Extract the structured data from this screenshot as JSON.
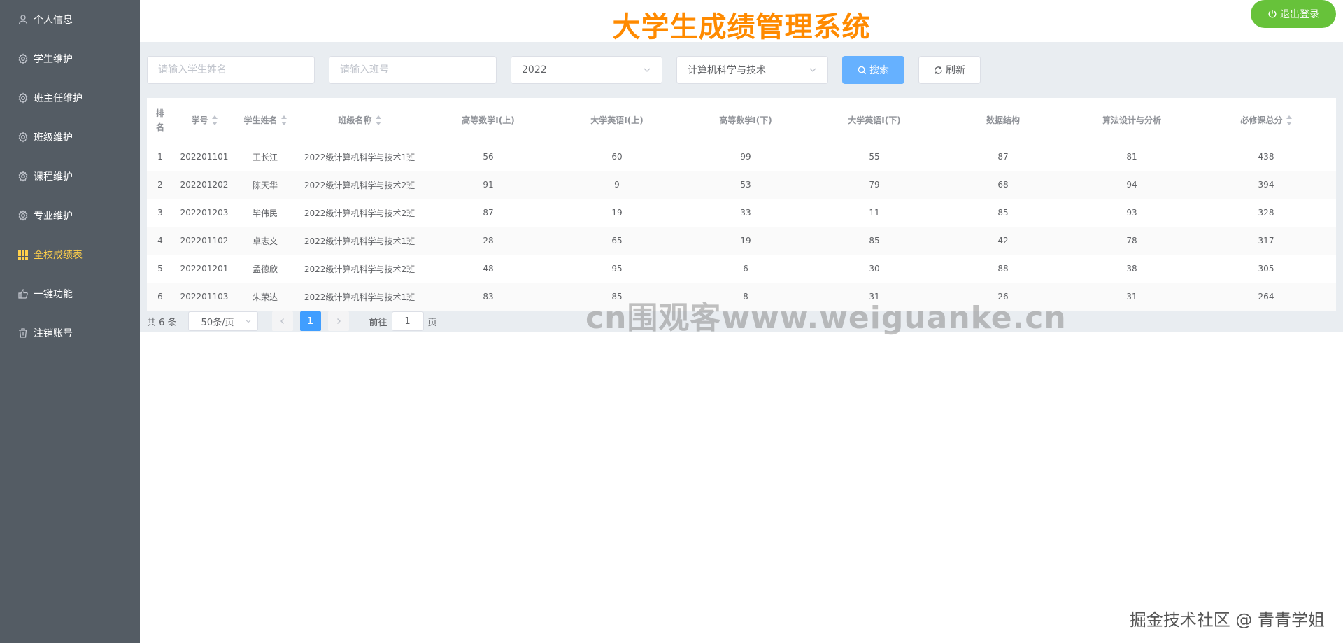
{
  "sidebar": {
    "items": [
      {
        "label": "个人信息",
        "icon": "user-icon",
        "active": false
      },
      {
        "label": "学生维护",
        "icon": "gear-icon",
        "active": false
      },
      {
        "label": "班主任维护",
        "icon": "gear-icon",
        "active": false
      },
      {
        "label": "班级维护",
        "icon": "gear-icon",
        "active": false
      },
      {
        "label": "课程维护",
        "icon": "gear-icon",
        "active": false
      },
      {
        "label": "专业维护",
        "icon": "gear-icon",
        "active": false
      },
      {
        "label": "全校成绩表",
        "icon": "grid-icon",
        "active": true
      },
      {
        "label": "一键功能",
        "icon": "thumb-icon",
        "active": false
      },
      {
        "label": "注销账号",
        "icon": "trash-icon",
        "active": false
      }
    ],
    "active_color": "#ffd04b",
    "background": "#545c64"
  },
  "header": {
    "title": "大学生成绩管理系统",
    "title_color": "#ff8a00",
    "logout_label": "退出登录"
  },
  "filters": {
    "name_placeholder": "请输入学生姓名",
    "class_placeholder": "请输入班号",
    "year_value": "2022",
    "major_value": "计算机科学与技术",
    "search_label": "搜索",
    "refresh_label": "刷新"
  },
  "table": {
    "headers": {
      "rank": "排名",
      "student_no": "学号",
      "name": "学生姓名",
      "class_name": "班级名称",
      "math1": "高等数学I(上)",
      "english1": "大学英语I(上)",
      "math2": "高等数学I(下)",
      "english2": "大学英语I(下)",
      "ds": "数据结构",
      "algo": "算法设计与分析",
      "total": "必修课总分"
    },
    "rows": [
      {
        "rank": "1",
        "student_no": "202201101",
        "name": "王长江",
        "class_name": "2022级计算机科学与技术1班",
        "math1": "56",
        "english1": "60",
        "math2": "99",
        "english2": "55",
        "ds": "87",
        "algo": "81",
        "total": "438"
      },
      {
        "rank": "2",
        "student_no": "202201202",
        "name": "陈天华",
        "class_name": "2022级计算机科学与技术2班",
        "math1": "91",
        "english1": "9",
        "math2": "53",
        "english2": "79",
        "ds": "68",
        "algo": "94",
        "total": "394"
      },
      {
        "rank": "3",
        "student_no": "202201203",
        "name": "毕伟民",
        "class_name": "2022级计算机科学与技术2班",
        "math1": "87",
        "english1": "19",
        "math2": "33",
        "english2": "11",
        "ds": "85",
        "algo": "93",
        "total": "328"
      },
      {
        "rank": "4",
        "student_no": "202201102",
        "name": "卓志文",
        "class_name": "2022级计算机科学与技术1班",
        "math1": "28",
        "english1": "65",
        "math2": "19",
        "english2": "85",
        "ds": "42",
        "algo": "78",
        "total": "317"
      },
      {
        "rank": "5",
        "student_no": "202201201",
        "name": "孟德欣",
        "class_name": "2022级计算机科学与技术2班",
        "math1": "48",
        "english1": "95",
        "math2": "6",
        "english2": "30",
        "ds": "88",
        "algo": "38",
        "total": "305"
      },
      {
        "rank": "6",
        "student_no": "202201103",
        "name": "朱荣达",
        "class_name": "2022级计算机科学与技术1班",
        "math1": "83",
        "english1": "85",
        "math2": "8",
        "english2": "31",
        "ds": "26",
        "algo": "31",
        "total": "264"
      }
    ]
  },
  "pagination": {
    "total_text": "共 6 条",
    "page_size": "50条/页",
    "current_page": "1",
    "goto_prefix": "前往",
    "goto_value": "1",
    "goto_suffix": "页"
  },
  "watermark": "cn围观客www.weiguanke.cn",
  "footer_mark": "掘金技术社区 @ 青青学姐"
}
